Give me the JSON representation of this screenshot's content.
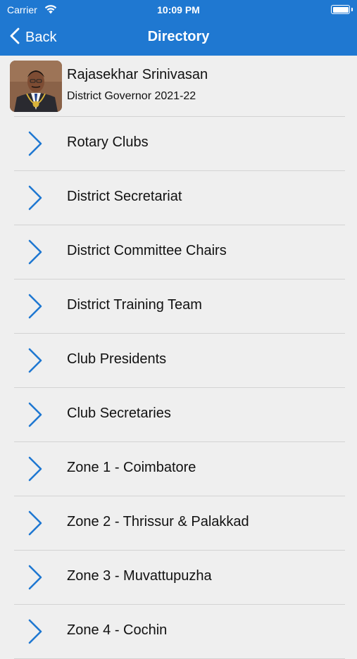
{
  "status_bar": {
    "carrier": "Carrier",
    "time": "10:09 PM",
    "wifi_icon": "wifi-icon",
    "battery_icon": "battery-icon"
  },
  "nav": {
    "back_label": "Back",
    "title": "Directory",
    "back_icon": "chevron-left-icon"
  },
  "profile": {
    "name": "Rajasekhar Srinivasan",
    "role": "District Governor 2021-22"
  },
  "directory": {
    "item_icon": "chevron-right-icon",
    "items": [
      {
        "label": "Rotary Clubs"
      },
      {
        "label": "District Secretariat"
      },
      {
        "label": "District Committee Chairs"
      },
      {
        "label": "District Training Team"
      },
      {
        "label": "Club Presidents"
      },
      {
        "label": "Club Secretaries"
      },
      {
        "label": "Zone 1 - Coimbatore"
      },
      {
        "label": "Zone 2 - Thrissur & Palakkad"
      },
      {
        "label": "Zone 3 - Muvattupuzha"
      },
      {
        "label": "Zone 4 - Cochin"
      }
    ]
  },
  "colors": {
    "header_bg": "#1f78d1",
    "background": "#efefef",
    "chevron": "#1f78d1",
    "divider": "#d3d3d3"
  }
}
